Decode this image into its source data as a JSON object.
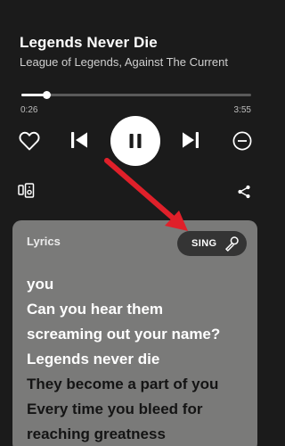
{
  "track": {
    "title": "Legends Never Die",
    "artist": "League of Legends, Against The Current"
  },
  "playback": {
    "elapsed": "0:26",
    "total": "3:55",
    "progress_fraction": 0.11,
    "state": "playing"
  },
  "icons": {
    "like": "heart-icon",
    "previous": "skip-previous-icon",
    "play_pause": "pause-icon",
    "next": "skip-next-icon",
    "remove": "minus-circle-icon",
    "devices": "connect-devices-icon",
    "share": "share-icon",
    "sing": "microphone-icon"
  },
  "lyrics": {
    "label": "Lyrics",
    "sing_label": "SING",
    "lines": [
      {
        "text": "you",
        "active": true
      },
      {
        "text": "Can you hear them",
        "active": true
      },
      {
        "text": "screaming out your name?",
        "active": true
      },
      {
        "text": "Legends never die",
        "active": true
      },
      {
        "text": "They become a part of you",
        "active": false
      },
      {
        "text": "Every time you bleed for",
        "active": false
      },
      {
        "text": "reaching greatness",
        "active": false
      }
    ]
  },
  "colors": {
    "background": "#1b1b1b",
    "lyrics_card": "#7a7a79",
    "sing_button": "#343434",
    "annotation_arrow": "#e0202a"
  }
}
